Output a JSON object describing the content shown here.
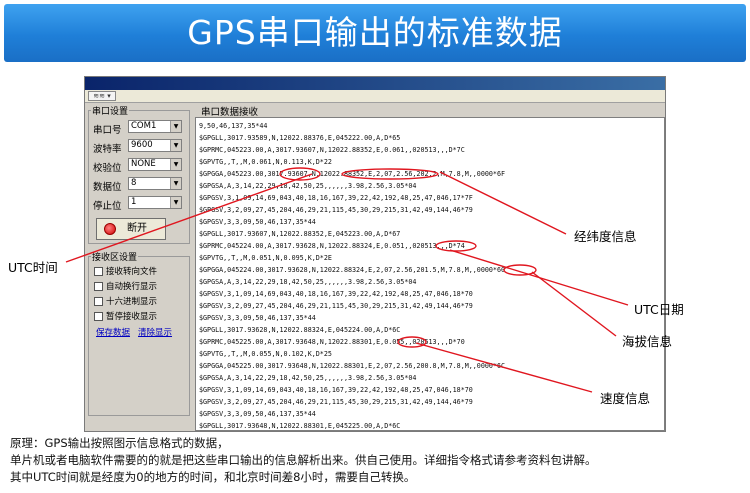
{
  "banner": {
    "title": "GPS串口输出的标准数据"
  },
  "toolbar": {
    "icon_label": "≋≋ ▾"
  },
  "serial_settings": {
    "group_title": "串口设置",
    "fields": [
      {
        "label": "串口号",
        "value": "COM1"
      },
      {
        "label": "波特率",
        "value": "9600"
      },
      {
        "label": "校验位",
        "value": "NONE"
      },
      {
        "label": "数据位",
        "value": "8"
      },
      {
        "label": "停止位",
        "value": "1"
      }
    ],
    "open_button": "断开"
  },
  "receive_settings": {
    "group_title": "接收区设置",
    "options": [
      "接收转向文件",
      "自动换行显示",
      "十六进制显示",
      "暂停接收显示"
    ],
    "save_link": "保存数据",
    "clear_link": "清除显示"
  },
  "data_panel": {
    "label": "串口数据接收",
    "lines": [
      "9,50,46,137,35*44",
      "$GPGLL,3017.93589,N,12022.88376,E,045222.00,A,D*65",
      "$GPRMC,045223.00,A,3017.93607,N,12022.88352,E,0.061,,020513,,,D*7C",
      "$GPVTG,,T,,M,0.061,N,0.113,K,D*22",
      "$GPGGA,045223.00,3017.93607,N,12022.88352,E,2,07,2.56,202.2,M,7.8,M,,0000*6F",
      "$GPGSA,A,3,14,22,29,18,42,50,25,,,,,,3.98,2.56,3.05*04",
      "$GPGSV,3,1,09,14,69,043,40,18,16,167,39,22,42,192,48,25,47,046,17*7F",
      "$GPGSV,3,2,09,27,45,204,46,29,21,115,45,30,29,215,31,42,49,144,46*79",
      "$GPGSV,3,3,09,50,46,137,35*44",
      "$GPGLL,3017.93607,N,12022.88352,E,045223.00,A,D*67",
      "$GPRMC,045224.00,A,3017.93628,N,12022.88324,E,0.051,,020513,,,D*74",
      "$GPVTG,,T,,M,0.051,N,0.095,K,D*2E",
      "$GPGGA,045224.00,3017.93628,N,12022.88324,E,2,07,2.56,201.5,M,7.8,M,,0000*60",
      "$GPGSA,A,3,14,22,29,18,42,50,25,,,,,,3.98,2.56,3.05*04",
      "$GPGSV,3,1,09,14,69,043,40,18,16,167,39,22,42,192,48,25,47,046,18*70",
      "$GPGSV,3,2,09,27,45,204,46,29,21,115,45,30,29,215,31,42,49,144,46*79",
      "$GPGSV,3,3,09,50,46,137,35*44",
      "$GPGLL,3017.93628,N,12022.88324,E,045224.00,A,D*6C",
      "$GPRMC,045225.00,A,3017.93648,N,12022.88301,E,0.055,,020513,,,D*70",
      "$GPVTG,,T,,M,0.055,N,0.102,K,D*25",
      "$GPGGA,045225.00,3017.93648,N,12022.88301,E,2,07,2.56,200.8,M,7.8,M,,0000*6C",
      "$GPGSA,A,3,14,22,29,18,42,50,25,,,,,,3.98,2.56,3.05*04",
      "$GPGSV,3,1,09,14,69,043,40,18,16,167,39,22,42,192,48,25,47,046,18*70",
      "$GPGSV,3,2,09,27,45,204,46,29,21,115,45,30,29,215,31,42,49,144,46*79",
      "$GPGSV,3,3,09,50,46,137,35*44",
      "$GPGLL,3017.93648,N,12022.88301,E,045225.00,A,D*6C"
    ]
  },
  "annotations": {
    "utc_time": "UTC时间",
    "lat_lon": "经纬度信息",
    "utc_date": "UTC日期",
    "altitude": "海拔信息",
    "speed": "速度信息"
  },
  "colors": {
    "banner": "#1f7fd8",
    "annotation_line": "#e0161f"
  },
  "footer": {
    "line1": "原理：GPS输出按照图示信息格式的数据，",
    "line2": "单片机或者电脑软件需要的的就是把这些串口输出的信息解析出来。供自己使用。详细指令格式请参考资料包讲解。",
    "line3": "其中UTC时间就是经度为0的地方的时间，和北京时间差8小时，需要自己转换。"
  }
}
